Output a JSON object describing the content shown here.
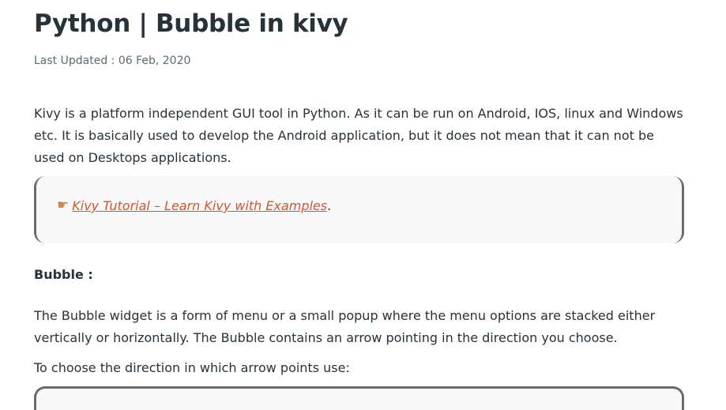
{
  "article": {
    "title": "Python | Bubble in kivy",
    "last_updated": "Last Updated : 06 Feb, 2020",
    "intro": "Kivy is a platform independent GUI tool in Python. As it can be run on Android, IOS, linux and Windows etc. It is basically used to develop the Android application, but it does not mean that it can not be used on Desktops applications.",
    "callout": {
      "icon": "pointing-hand-icon",
      "link_text": "Kivy Tutorial – Learn Kivy with Examples",
      "trailing": "."
    },
    "section_heading": "Bubble :",
    "bubble_description": "The Bubble widget is a form of menu or a small popup where the menu options are stacked either vertically or horizontally. The Bubble contains an arrow pointing in the direction you choose.",
    "direction_intro": "To choose the direction in which arrow points use:"
  },
  "colors": {
    "text": "#273239",
    "muted": "#5b6b73",
    "link": "#d1582b",
    "callout_bg": "#f8f8f8",
    "callout_border": "#6b6b6b"
  }
}
